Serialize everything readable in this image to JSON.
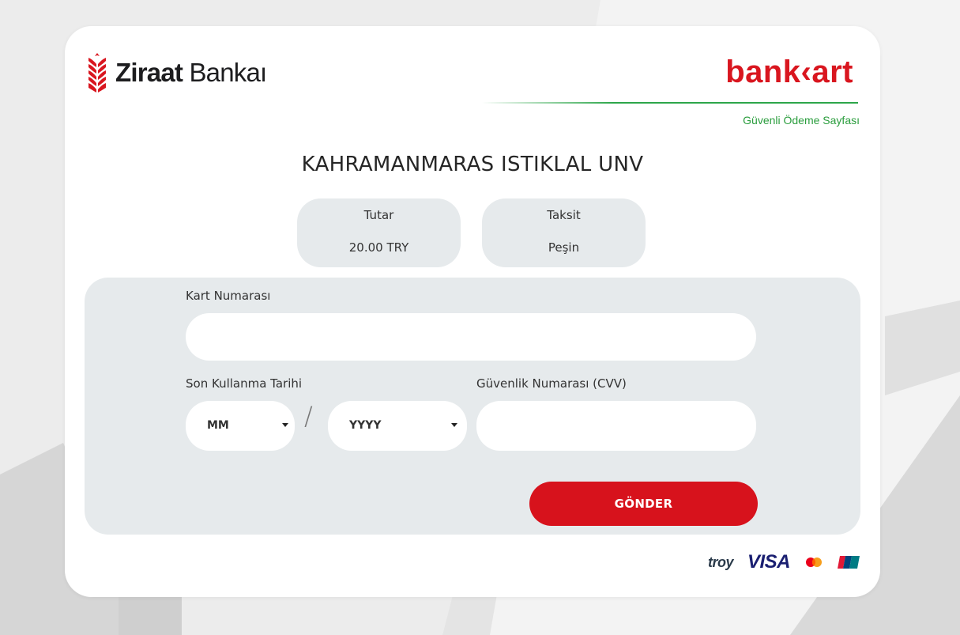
{
  "header": {
    "bank_name_bold": "Ziraat",
    "bank_name_regular": "Bankaı",
    "card_brand": "bank‹art",
    "secure_label": "Güvenli Ödeme Sayfası"
  },
  "merchant": {
    "name": "KAHRAMANMARAS ISTIKLAL UNV"
  },
  "summary": {
    "amount_label": "Tutar",
    "amount_value": "20.00 TRY",
    "installment_label": "Taksit",
    "installment_value": "Peşin"
  },
  "form": {
    "card_number_label": "Kart Numarası",
    "card_number_value": "",
    "expiry_label": "Son Kullanma Tarihi",
    "month_selected": "MM",
    "year_selected": "YYYY",
    "separator": "/",
    "cvv_label": "Güvenlik Numarası (CVV)",
    "cvv_value": "",
    "submit_label": "GÖNDER"
  },
  "brands": {
    "troy": "troy",
    "visa": "VISA"
  },
  "colors": {
    "accent_red": "#d7121c",
    "secure_green": "#2da64a",
    "panel_gray": "#e6eaec"
  },
  "icons": [
    "ziraat-wheat-icon",
    "mastercard-icon",
    "unionpay-icon"
  ]
}
